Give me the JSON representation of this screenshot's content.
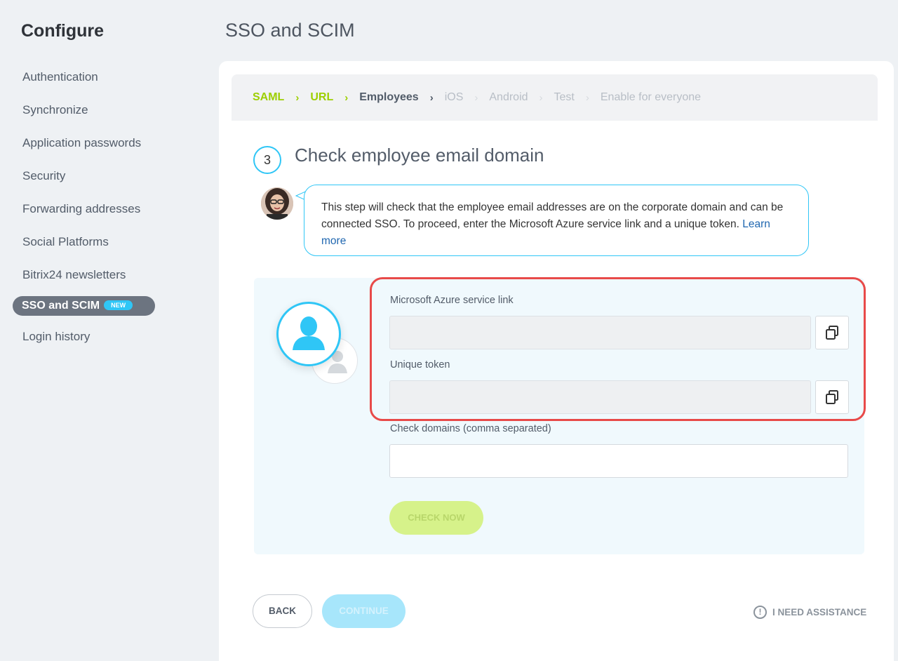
{
  "sidebar": {
    "title": "Configure",
    "items": [
      {
        "label": "Authentication"
      },
      {
        "label": "Synchronize"
      },
      {
        "label": "Application passwords"
      },
      {
        "label": "Security"
      },
      {
        "label": "Forwarding addresses"
      },
      {
        "label": "Social Platforms"
      },
      {
        "label": "Bitrix24 newsletters"
      },
      {
        "label": "SSO and SCIM",
        "badge": "NEW",
        "active": true
      },
      {
        "label": "Login history"
      }
    ]
  },
  "header": {
    "title": "SSO and SCIM"
  },
  "steps": [
    {
      "label": "SAML",
      "state": "done"
    },
    {
      "label": "URL",
      "state": "done"
    },
    {
      "label": "Employees",
      "state": "current"
    },
    {
      "label": "iOS",
      "state": "future"
    },
    {
      "label": "Android",
      "state": "future"
    },
    {
      "label": "Test",
      "state": "future"
    },
    {
      "label": "Enable for everyone",
      "state": "future"
    }
  ],
  "step": {
    "number": "3",
    "heading": "Check employee email domain"
  },
  "bubble": {
    "text": "This step will check that the employee email addresses are on the corporate domain and can be connected SSO. To proceed, enter the Microsoft Azure service link and a unique token.",
    "link": "Learn more"
  },
  "form": {
    "azure_label": "Microsoft Azure service link",
    "azure_value": "",
    "token_label": "Unique token",
    "token_value": "",
    "domains_label": "Check domains (comma separated)",
    "domains_value": "",
    "check_button": "CHECK NOW"
  },
  "footer": {
    "back": "BACK",
    "continue": "CONTINUE",
    "assist": "I NEED ASSISTANCE"
  },
  "colors": {
    "accent": "#2fc6f6",
    "done": "#9dcf00",
    "highlight": "#e84a49"
  }
}
